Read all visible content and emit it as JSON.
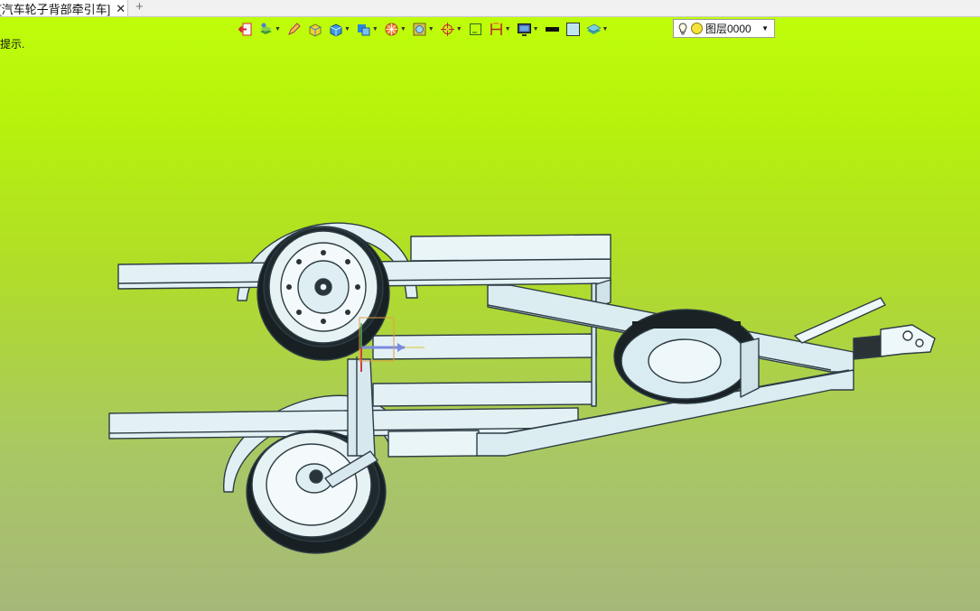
{
  "tab": {
    "title": "[汽车轮子背部牵引车]",
    "close_glyph": "✕",
    "add_glyph": "+"
  },
  "toolbar": {
    "items": [
      {
        "icon": "exit-sketch-icon"
      },
      {
        "icon": "layer-stack-icon",
        "dropdown": true
      },
      {
        "icon": "pen-tool-icon"
      },
      {
        "icon": "shaded-cube-icon"
      },
      {
        "icon": "blue-cube-icon",
        "dropdown": true
      },
      {
        "icon": "view-orient-icon",
        "dropdown": true
      },
      {
        "icon": "render-sphere-icon",
        "dropdown": true
      },
      {
        "icon": "filter-icon",
        "dropdown": true
      },
      {
        "icon": "snap-target-icon",
        "dropdown": true
      },
      {
        "icon": "frame-select-icon"
      },
      {
        "icon": "dimension-icon",
        "dropdown": true
      },
      {
        "icon": "display-monitor-icon",
        "dropdown": true
      },
      {
        "icon": "line-color-icon"
      },
      {
        "icon": "fill-color-icon"
      },
      {
        "icon": "layer-plane-icon",
        "dropdown": true
      }
    ],
    "layer": {
      "label": "图层0000",
      "arrow": "▼"
    }
  },
  "hint": "提示.",
  "colors": {
    "frame": "#dfeff3",
    "frame_stroke": "#2e3d44",
    "tire": "#e8f2f4"
  }
}
